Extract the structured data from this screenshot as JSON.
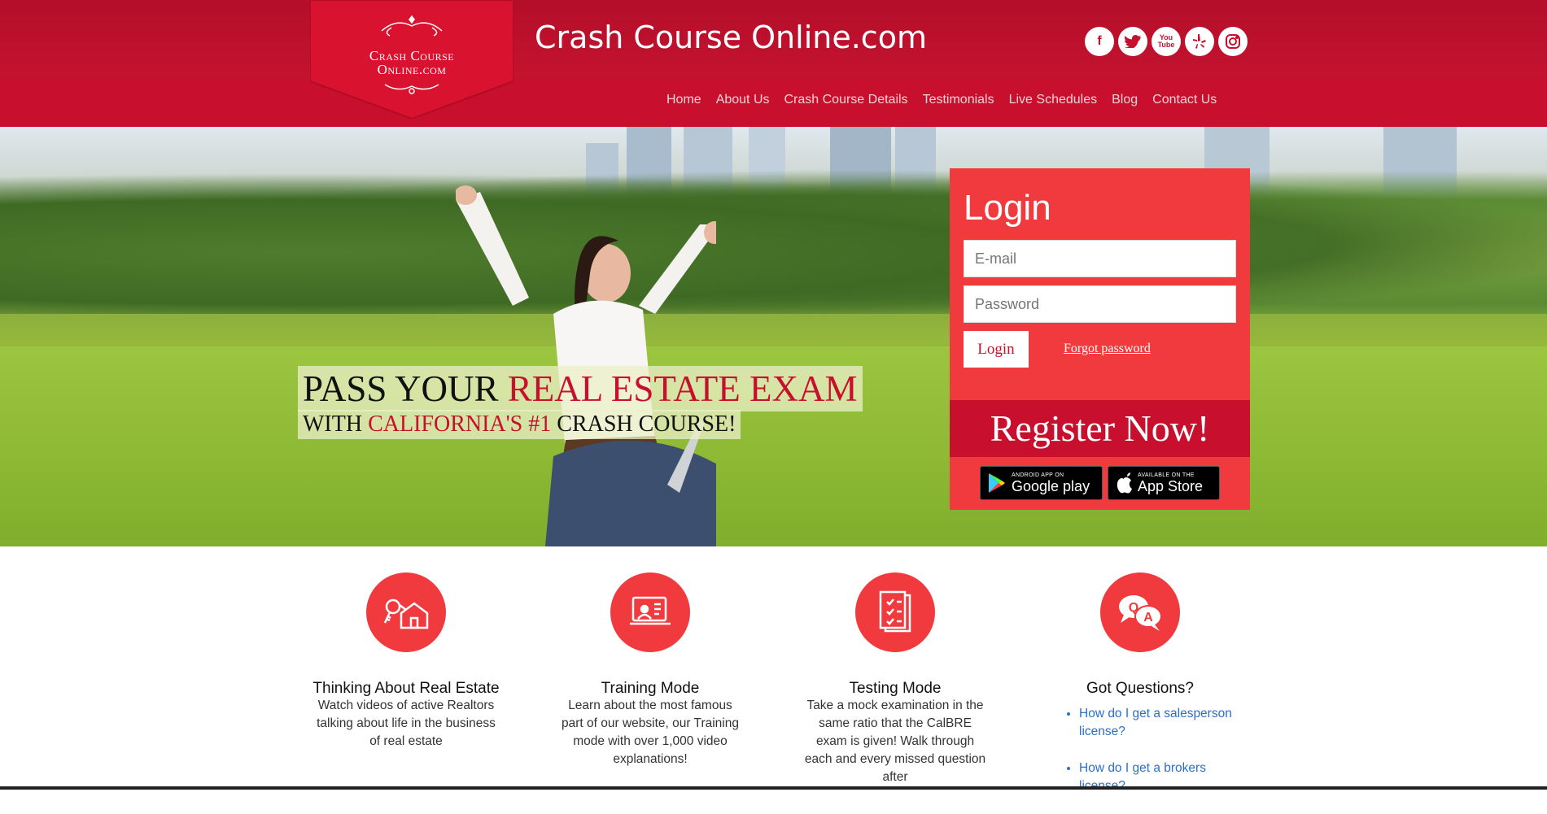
{
  "header": {
    "logo_line1": "Crash Course",
    "logo_line2": "Online.com",
    "site_title": "Crash Course Online.com",
    "social": [
      "facebook-icon",
      "twitter-icon",
      "youtube-icon",
      "yelp-icon",
      "instagram-icon"
    ],
    "youtube_text": "You Tube",
    "nav": [
      "Home",
      "About Us",
      "Crash Course Details",
      "Testimonials",
      "Live Schedules",
      "Blog",
      "Contact Us"
    ]
  },
  "hero": {
    "line1_a": "PASS YOUR ",
    "line1_b": "REAL ESTATE EXAM",
    "line2_a": "WITH ",
    "line2_b": "CALIFORNIA'S #1",
    "line2_c": " CRASH COURSE!"
  },
  "login": {
    "title": "Login",
    "email_placeholder": "E-mail",
    "password_placeholder": "Password",
    "button": "Login",
    "forgot": "Forgot password",
    "register": "Register Now!",
    "google_small": "ANDROID APP ON",
    "google_big": "Google play",
    "apple_small": "AVAILABLE ON THE",
    "apple_big": "App Store"
  },
  "features": [
    {
      "title": "Thinking About Real Estate",
      "text": "Watch videos of active Realtors talking about life in the business of real estate"
    },
    {
      "title": "Training Mode",
      "text": "Learn about the most famous part of our website, our Training mode with over 1,000 video explanations!"
    },
    {
      "title": "Testing Mode",
      "text": "Take a mock examination in the same ratio that the CalBRE exam is given! Walk through each and every missed question after"
    },
    {
      "title": "Got Questions?",
      "questions": [
        "How do I get a salesperson license?",
        "How do I get a brokers license?"
      ]
    }
  ],
  "colors": {
    "brand_red": "#c8102e",
    "panel_red": "#f03a3e",
    "link_blue": "#2a6fc9"
  }
}
